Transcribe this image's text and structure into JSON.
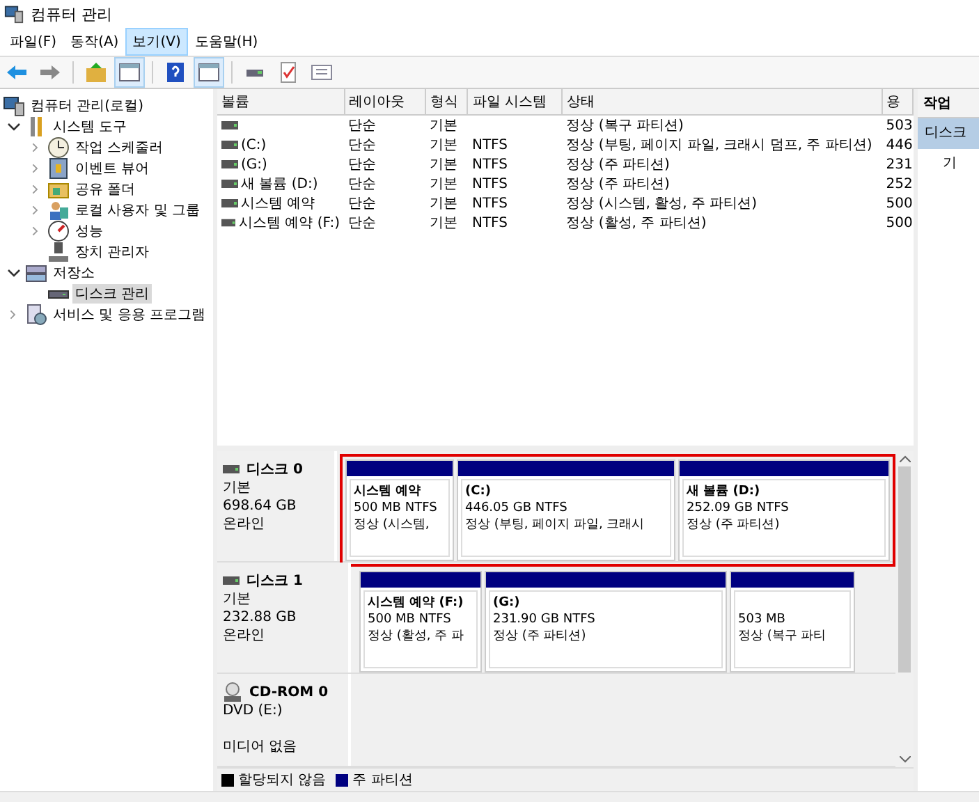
{
  "window": {
    "title": "컴퓨터 관리"
  },
  "menu": [
    {
      "label": "파일(F)",
      "selected": false
    },
    {
      "label": "동작(A)",
      "selected": false
    },
    {
      "label": "보기(V)",
      "selected": true
    },
    {
      "label": "도움말(H)",
      "selected": false
    }
  ],
  "toolbar": [
    {
      "pressed": false
    },
    {
      "pressed": false
    },
    {
      "pressed": false
    },
    {
      "pressed": true
    },
    {
      "pressed": false
    },
    {
      "pressed": true
    },
    {
      "pressed": false
    },
    {
      "pressed": false
    },
    {
      "pressed": false
    }
  ],
  "tree": [
    {
      "label": "컴퓨터 관리(로컬)",
      "selected": false,
      "children": [
        {
          "label": "시스템 도구",
          "expanded": true,
          "selected": false,
          "children": [
            {
              "label": "작업 스케줄러",
              "expanded": false,
              "selected": false
            },
            {
              "label": "이벤트 뷰어",
              "expanded": false,
              "selected": false
            },
            {
              "label": "공유 폴더",
              "expanded": false,
              "selected": false
            },
            {
              "label": "로컬 사용자 및 그룹",
              "expanded": false,
              "selected": false
            },
            {
              "label": "성능",
              "expanded": false,
              "selected": false
            },
            {
              "label": "장치 관리자",
              "selected": false
            }
          ]
        },
        {
          "label": "저장소",
          "expanded": true,
          "selected": false,
          "children": [
            {
              "label": "디스크 관리",
              "selected": true
            }
          ]
        },
        {
          "label": "서비스 및 응용 프로그램",
          "expanded": false,
          "selected": false
        }
      ]
    }
  ],
  "table": {
    "columns": [
      "볼륨",
      "레이아웃",
      "형식",
      "파일 시스템",
      "상태",
      "용"
    ],
    "rows": [
      {
        "volume": "",
        "layout": "단순",
        "type": "기본",
        "fs": "",
        "status": "정상 (복구 파티션)",
        "capacity": "503"
      },
      {
        "volume": " (C:)",
        "layout": "단순",
        "type": "기본",
        "fs": "NTFS",
        "status": "정상 (부팅, 페이지 파일, 크래시 덤프, 주 파티션)",
        "capacity": "446"
      },
      {
        "volume": " (G:)",
        "layout": "단순",
        "type": "기본",
        "fs": "NTFS",
        "status": "정상 (주 파티션)",
        "capacity": "231"
      },
      {
        "volume": "새 볼륨 (D:)",
        "layout": "단순",
        "type": "기본",
        "fs": "NTFS",
        "status": "정상 (주 파티션)",
        "capacity": "252"
      },
      {
        "volume": "시스템 예약",
        "layout": "단순",
        "type": "기본",
        "fs": "NTFS",
        "status": "정상 (시스템, 활성, 주 파티션)",
        "capacity": "500"
      },
      {
        "volume": "시스템 예약 (F:)",
        "layout": "단순",
        "type": "기본",
        "fs": "NTFS",
        "status": "정상 (활성, 주 파티션)",
        "capacity": "500"
      }
    ]
  },
  "disks": [
    {
      "kind": "disk",
      "name": "디스크 0",
      "type": "기본",
      "size": "698.64 GB",
      "status": "온라인",
      "selected": true,
      "partitions": [
        {
          "name": "시스템 예약",
          "size": "500 MB NTFS",
          "status": "정상 (시스템,",
          "color": "#000080"
        },
        {
          "name": " (C:)",
          "size": "446.05 GB NTFS",
          "status": "정상 (부팅, 페이지 파일, 크래시",
          "color": "#000080"
        },
        {
          "name": "새 볼륨  (D:)",
          "size": "252.09 GB NTFS",
          "status": "정상 (주 파티션)",
          "color": "#000080"
        }
      ]
    },
    {
      "kind": "disk",
      "name": "디스크 1",
      "type": "기본",
      "size": "232.88 GB",
      "status": "온라인",
      "selected": false,
      "partitions": [
        {
          "name": "시스템 예약  (F:)",
          "size": "500 MB NTFS",
          "status": "정상 (활성, 주 파",
          "color": "#000080"
        },
        {
          "name": " (G:)",
          "size": "231.90 GB NTFS",
          "status": "정상 (주 파티션)",
          "color": "#000080"
        },
        {
          "size": "503 MB",
          "status": "정상 (복구 파티",
          "color": "#000080"
        }
      ]
    },
    {
      "kind": "cdrom",
      "name": "CD-ROM 0",
      "type": "DVD (E:)",
      "status": "미디어 없음",
      "selected": false
    }
  ],
  "legend": [
    {
      "label": "할당되지 않음",
      "color": "#000000"
    },
    {
      "label": "주 파티션",
      "color": "#000080"
    }
  ],
  "actions": {
    "title": "작업",
    "items": [
      {
        "label": "디스크",
        "kind": "header",
        "selected": true
      },
      {
        "label": "기",
        "kind": "item",
        "selected": false
      }
    ]
  }
}
